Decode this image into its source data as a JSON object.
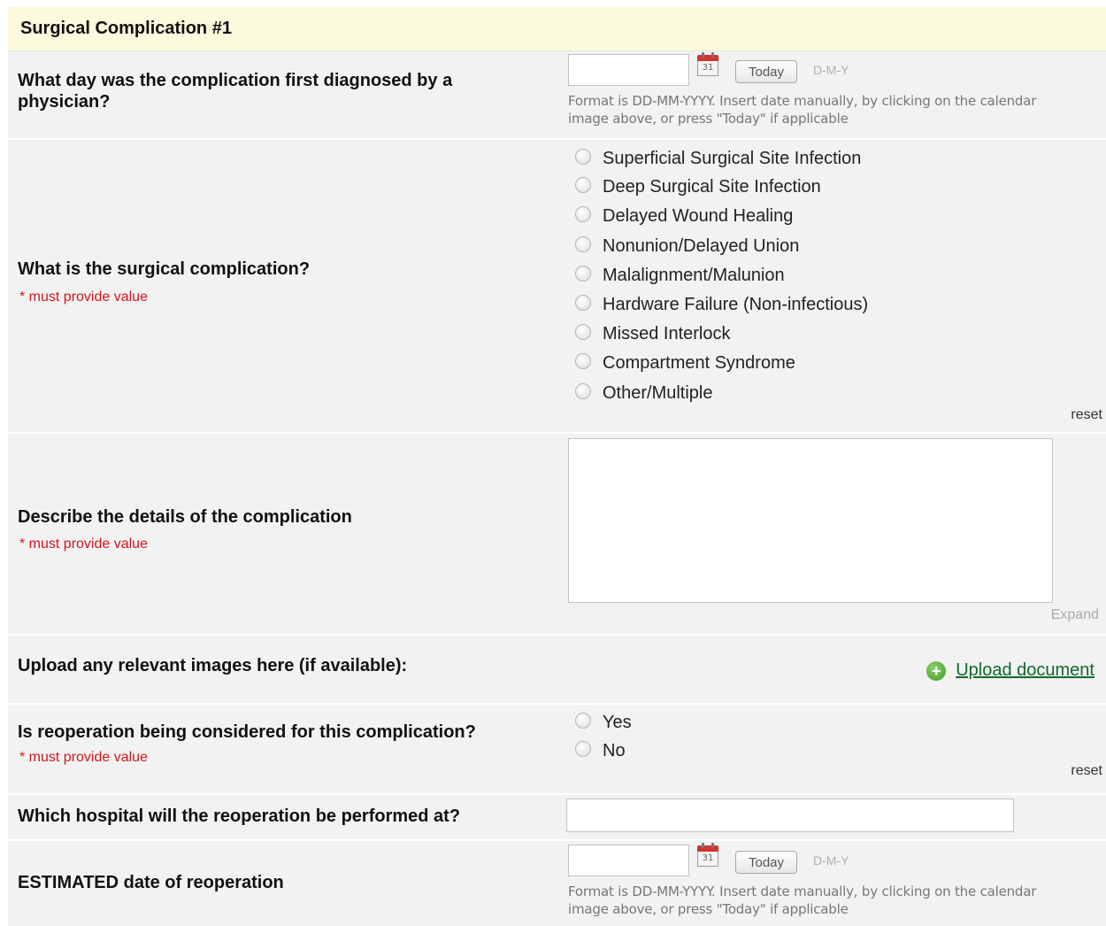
{
  "section": {
    "title": "Surgical Complication #1"
  },
  "diagnosed_date": {
    "question": "What day was the complication first diagnosed by a physician?",
    "value": "",
    "today_label": "Today",
    "format_hint": "D-M-Y",
    "help": "Format is DD-MM-YYYY. Insert date manually, by clicking on the calendar image above, or press \"Today\" if applicable",
    "calendar_day": "31"
  },
  "complication": {
    "question": "What is the surgical complication?",
    "required": "* must provide value",
    "options": [
      "Superficial Surgical Site Infection",
      "Deep Surgical Site Infection",
      "Delayed Wound Healing",
      "Nonunion/Delayed Union",
      "Malalignment/Malunion",
      "Hardware Failure (Non-infectious)",
      "Missed Interlock",
      "Compartment Syndrome",
      "Other/Multiple"
    ],
    "selected": null,
    "reset_label": "reset"
  },
  "details": {
    "question": "Describe the details of the complication",
    "required": "* must provide value",
    "value": "",
    "expand_label": "Expand"
  },
  "upload": {
    "question": "Upload any relevant images here (if available):",
    "link_label": "Upload document",
    "icon": "plus-circle-icon"
  },
  "reoperation": {
    "question": "Is reoperation being considered for this complication?",
    "required": "* must provide value",
    "options": [
      "Yes",
      "No"
    ],
    "selected": null,
    "reset_label": "reset"
  },
  "hospital": {
    "question": "Which hospital will the reoperation be performed at?",
    "value": ""
  },
  "reop_date": {
    "question": "ESTIMATED date of reoperation",
    "value": "",
    "today_label": "Today",
    "format_hint": "D-M-Y",
    "help": "Format is DD-MM-YYYY. Insert date manually, by clicking on the calendar image above, or press \"Today\" if applicable",
    "calendar_day": "31"
  },
  "colors": {
    "header_bg": "#fcfadc",
    "row_bg": "#f2f2f2",
    "required": "#d4141c",
    "link": "#0e6b2a"
  }
}
